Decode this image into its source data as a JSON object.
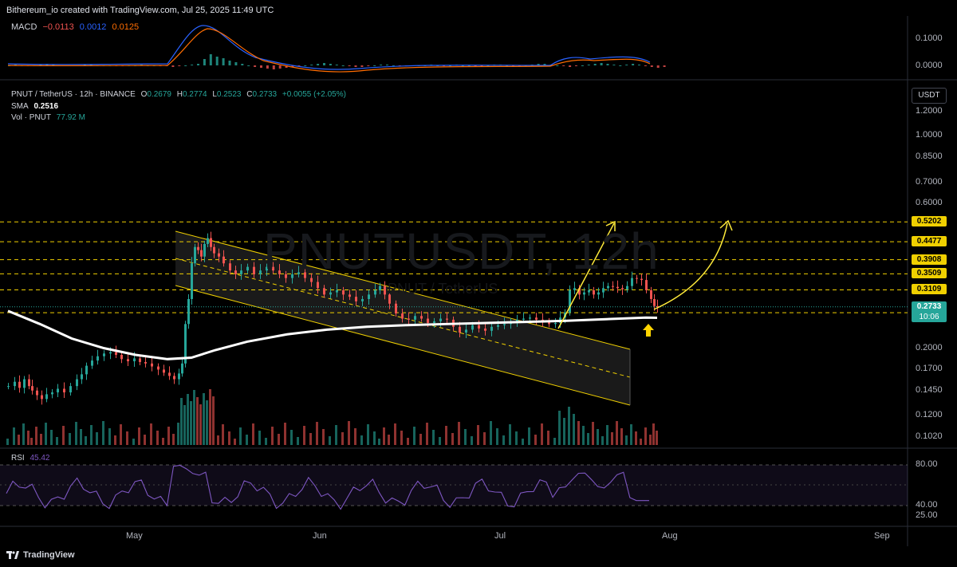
{
  "header": {
    "text": "Bithereum_io created with TradingView.com, Jul 25, 2025 11:49 UTC"
  },
  "macd": {
    "label": "MACD",
    "hist": "−0.0113",
    "macd_line": "0.0012",
    "signal": "0.0125",
    "ticks": [
      "0.1000",
      "0.0000"
    ]
  },
  "main": {
    "symbol": "PNUT / TetherUS · 12h · BINANCE",
    "o_label": "O",
    "o": "0.2679",
    "h_label": "H",
    "h": "0.2774",
    "l_label": "L",
    "l": "0.2523",
    "c_label": "C",
    "c": "0.2733",
    "change": "+0.0055 (+2.05%)",
    "sma_label": "SMA",
    "sma": "0.2516",
    "vol_label": "Vol · PNUT",
    "vol": "77.92 M",
    "watermark": "PNUTUSDT, 12h",
    "watermark_sub": "PNUT / TetherUS",
    "currency_button": "USDT",
    "price_ticks": [
      "1.2000",
      "1.0000",
      "0.8500",
      "0.7000",
      "0.6000",
      "0.2000",
      "0.1700",
      "0.1450",
      "0.1200",
      "0.1020"
    ],
    "price_lines": [
      {
        "value": "0.5202",
        "color": "#f0d000"
      },
      {
        "value": "0.4477",
        "color": "#f0d000"
      },
      {
        "value": "0.3908",
        "color": "#f0d000"
      },
      {
        "value": "0.3509",
        "color": "#f0d000"
      },
      {
        "value": "0.3109",
        "color": "#f0d000"
      },
      {
        "value": "0.2614",
        "color": "#f0d000"
      }
    ],
    "last_price": {
      "value": "0.2733",
      "countdown": "10:06",
      "color": "#26a69a"
    }
  },
  "rsi": {
    "label": "RSI",
    "value": "45.42",
    "ticks": [
      "80.00",
      "40.00",
      "25.00"
    ]
  },
  "time_axis": [
    "May",
    "Jun",
    "Jul",
    "Aug",
    "Sep"
  ],
  "footer": {
    "brand": "TradingView"
  },
  "colors": {
    "up": "#26a69a",
    "down": "#ef5350",
    "level": "#f0d000",
    "sma": "#ffffff",
    "macd": "#2962ff",
    "signal": "#ff6d00",
    "rsi": "#7e57c2",
    "arrow": "#ffeb3b"
  },
  "chart_data": {
    "type": "candlestick",
    "symbol": "PNUT / TetherUS",
    "interval": "12h",
    "exchange": "BINANCE",
    "y_scale": "log",
    "ylim": [
      0.097,
      1.3
    ],
    "series": [
      {
        "name": "PNUT / TetherUS",
        "type": "candlestick",
        "path": [
          [
            0,
            0.15
          ],
          [
            8,
            0.155
          ],
          [
            14,
            0.148
          ],
          [
            20,
            0.158
          ],
          [
            26,
            0.15
          ],
          [
            30,
            0.145
          ],
          [
            36,
            0.14
          ],
          [
            42,
            0.136
          ],
          [
            48,
            0.141
          ],
          [
            55,
            0.143
          ],
          [
            62,
            0.147
          ],
          [
            70,
            0.143
          ],
          [
            78,
            0.15
          ],
          [
            86,
            0.158
          ],
          [
            92,
            0.164
          ],
          [
            98,
            0.175
          ],
          [
            105,
            0.182
          ],
          [
            112,
            0.188
          ],
          [
            120,
            0.192
          ],
          [
            128,
            0.194
          ],
          [
            135,
            0.19
          ],
          [
            142,
            0.184
          ],
          [
            150,
            0.181
          ],
          [
            158,
            0.185
          ],
          [
            165,
            0.18
          ],
          [
            172,
            0.178
          ],
          [
            180,
            0.174
          ],
          [
            188,
            0.17
          ],
          [
            195,
            0.166
          ],
          [
            202,
            0.162
          ],
          [
            208,
            0.158
          ],
          [
            214,
            0.165
          ],
          [
            218,
            0.178
          ],
          [
            222,
            0.24
          ],
          [
            226,
            0.29
          ],
          [
            230,
            0.38
          ],
          [
            234,
            0.43
          ],
          [
            238,
            0.42
          ],
          [
            242,
            0.4
          ],
          [
            246,
            0.44
          ],
          [
            250,
            0.46
          ],
          [
            254,
            0.43
          ],
          [
            258,
            0.41
          ],
          [
            264,
            0.4
          ],
          [
            270,
            0.38
          ],
          [
            278,
            0.36
          ],
          [
            285,
            0.35
          ],
          [
            292,
            0.36
          ],
          [
            300,
            0.37
          ],
          [
            308,
            0.35
          ],
          [
            316,
            0.36
          ],
          [
            324,
            0.37
          ],
          [
            332,
            0.36
          ],
          [
            340,
            0.35
          ],
          [
            348,
            0.34
          ],
          [
            356,
            0.35
          ],
          [
            364,
            0.355
          ],
          [
            372,
            0.34
          ],
          [
            380,
            0.33
          ],
          [
            388,
            0.315
          ],
          [
            396,
            0.3
          ],
          [
            404,
            0.305
          ],
          [
            412,
            0.31
          ],
          [
            420,
            0.3
          ],
          [
            428,
            0.295
          ],
          [
            436,
            0.285
          ],
          [
            444,
            0.29
          ],
          [
            452,
            0.3
          ],
          [
            460,
            0.31
          ],
          [
            466,
            0.32
          ],
          [
            472,
            0.3
          ],
          [
            478,
            0.28
          ],
          [
            486,
            0.26
          ],
          [
            494,
            0.25
          ],
          [
            502,
            0.248
          ],
          [
            510,
            0.255
          ],
          [
            518,
            0.25
          ],
          [
            526,
            0.242
          ],
          [
            534,
            0.245
          ],
          [
            542,
            0.25
          ],
          [
            550,
            0.248
          ],
          [
            558,
            0.235
          ],
          [
            566,
            0.225
          ],
          [
            574,
            0.23
          ],
          [
            582,
            0.238
          ],
          [
            590,
            0.232
          ],
          [
            598,
            0.228
          ],
          [
            606,
            0.235
          ],
          [
            614,
            0.238
          ],
          [
            622,
            0.24
          ],
          [
            630,
            0.245
          ],
          [
            638,
            0.248
          ],
          [
            646,
            0.25
          ],
          [
            654,
            0.252
          ],
          [
            662,
            0.248
          ],
          [
            670,
            0.245
          ],
          [
            678,
            0.24
          ],
          [
            686,
            0.242
          ],
          [
            692,
            0.252
          ],
          [
            698,
            0.262
          ],
          [
            704,
            0.31
          ],
          [
            710,
            0.315
          ],
          [
            716,
            0.3
          ],
          [
            722,
            0.305
          ],
          [
            728,
            0.31
          ],
          [
            734,
            0.3
          ],
          [
            740,
            0.305
          ],
          [
            746,
            0.315
          ],
          [
            752,
            0.32
          ],
          [
            758,
            0.318
          ],
          [
            764,
            0.315
          ],
          [
            770,
            0.312
          ],
          [
            776,
            0.32
          ],
          [
            782,
            0.34
          ],
          [
            788,
            0.338
          ],
          [
            794,
            0.335
          ],
          [
            800,
            0.31
          ],
          [
            806,
            0.29
          ],
          [
            810,
            0.275
          ],
          [
            814,
            0.273
          ]
        ]
      },
      {
        "name": "SMA",
        "type": "line",
        "path": [
          [
            0,
            0.265
          ],
          [
            40,
            0.24
          ],
          [
            80,
            0.215
          ],
          [
            120,
            0.2
          ],
          [
            160,
            0.19
          ],
          [
            200,
            0.184
          ],
          [
            230,
            0.186
          ],
          [
            260,
            0.197
          ],
          [
            300,
            0.21
          ],
          [
            350,
            0.222
          ],
          [
            400,
            0.23
          ],
          [
            450,
            0.235
          ],
          [
            500,
            0.238
          ],
          [
            550,
            0.24
          ],
          [
            600,
            0.242
          ],
          [
            650,
            0.244
          ],
          [
            700,
            0.246
          ],
          [
            750,
            0.249
          ],
          [
            800,
            0.252
          ],
          [
            814,
            0.2516
          ]
        ]
      }
    ],
    "levels": [
      0.5202,
      0.4477,
      0.3908,
      0.3509,
      0.3109,
      0.2614
    ],
    "macd": {
      "hist": -0.0113,
      "macd": 0.0012,
      "signal": 0.0125
    },
    "rsi": 45.42,
    "x_ticks": [
      "May",
      "Jun",
      "Jul",
      "Aug",
      "Sep"
    ]
  }
}
